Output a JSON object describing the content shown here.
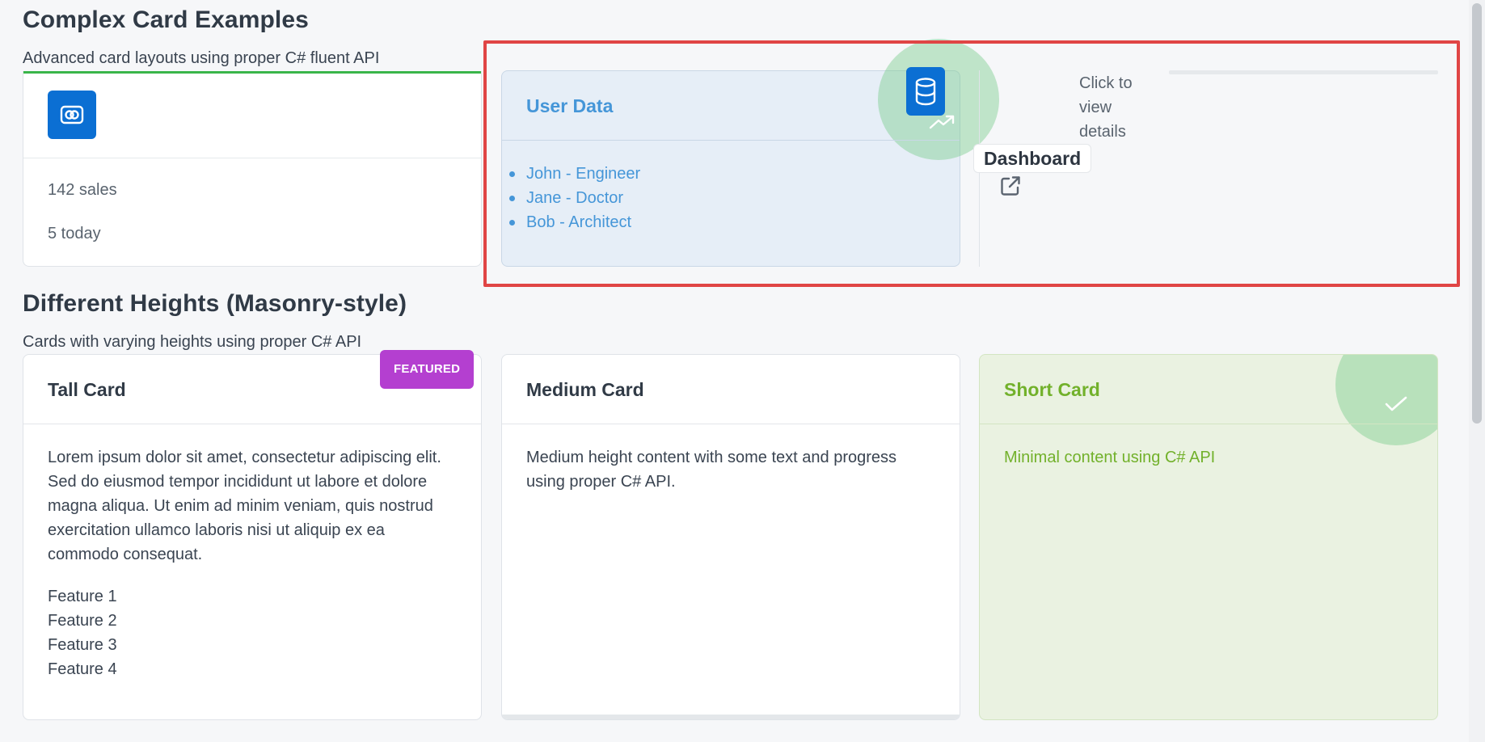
{
  "complex": {
    "title": "Complex Card Examples",
    "subtitle": "Advanced card layouts using proper C# fluent API",
    "sales_card": {
      "icon": "brand-infinity-icon",
      "stat1": "142 sales",
      "stat2": "5 today"
    },
    "user_data_card": {
      "title": "User Data",
      "icon": "database-icon",
      "trend_icon": "trending-up-icon",
      "items": [
        "John - Engineer",
        "Jane - Doctor",
        "Bob - Architect"
      ]
    },
    "dashboard_link": {
      "label": "Dashboard",
      "icon": "external-link-icon",
      "hint": "Click to view details"
    }
  },
  "masonry": {
    "title": "Different Heights (Masonry-style)",
    "subtitle": "Cards with varying heights using proper C# API",
    "tall_card": {
      "title": "Tall Card",
      "badge": "FEATURED",
      "body": "Lorem ipsum dolor sit amet, consectetur adipiscing elit. Sed do eiusmod tempor incididunt ut labore et dolore magna aliqua. Ut enim ad minim veniam, quis nostrud exercitation ullamco laboris nisi ut aliquip ex ea commodo consequat.",
      "features": [
        "Feature 1",
        "Feature 2",
        "Feature 3",
        "Feature 4"
      ]
    },
    "medium_card": {
      "title": "Medium Card",
      "body": "Medium height content with some text and progress using proper C# API."
    },
    "short_card": {
      "title": "Short Card",
      "body": "Minimal content using C# API",
      "icon": "check-icon"
    }
  },
  "colors": {
    "primary": "#0b6fd3",
    "info_text": "#4596d8",
    "success_text": "#72b12b",
    "featured": "#b43fd0",
    "highlight": "#e04545",
    "accent_green": "#3ab54a"
  }
}
